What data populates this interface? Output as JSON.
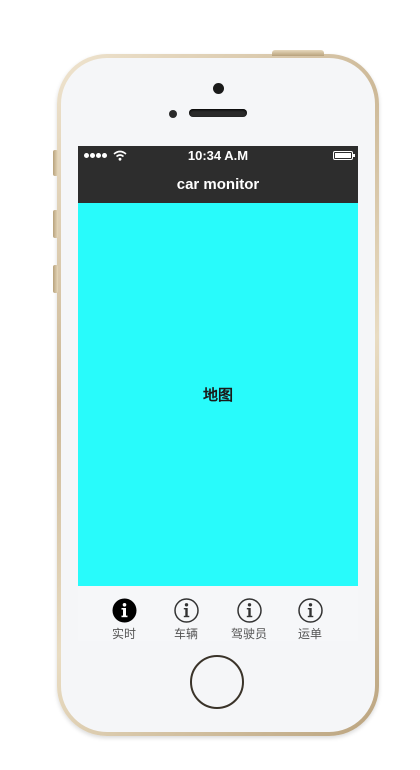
{
  "status_bar": {
    "time": "10:34 A.M"
  },
  "nav": {
    "title": "car monitor"
  },
  "map": {
    "label": "地图",
    "background": "#28fbfb"
  },
  "tabs": [
    {
      "label": "实时",
      "icon": "info-icon",
      "active": true
    },
    {
      "label": "车辆",
      "icon": "info-icon",
      "active": false
    },
    {
      "label": "驾驶员",
      "icon": "info-icon",
      "active": false
    },
    {
      "label": "运单",
      "icon": "info-icon",
      "active": false
    }
  ],
  "colors": {
    "nav_background": "#2d2d2d",
    "map_background": "#28fbfb",
    "active_icon": "#000000",
    "inactive_icon": "#333333"
  }
}
